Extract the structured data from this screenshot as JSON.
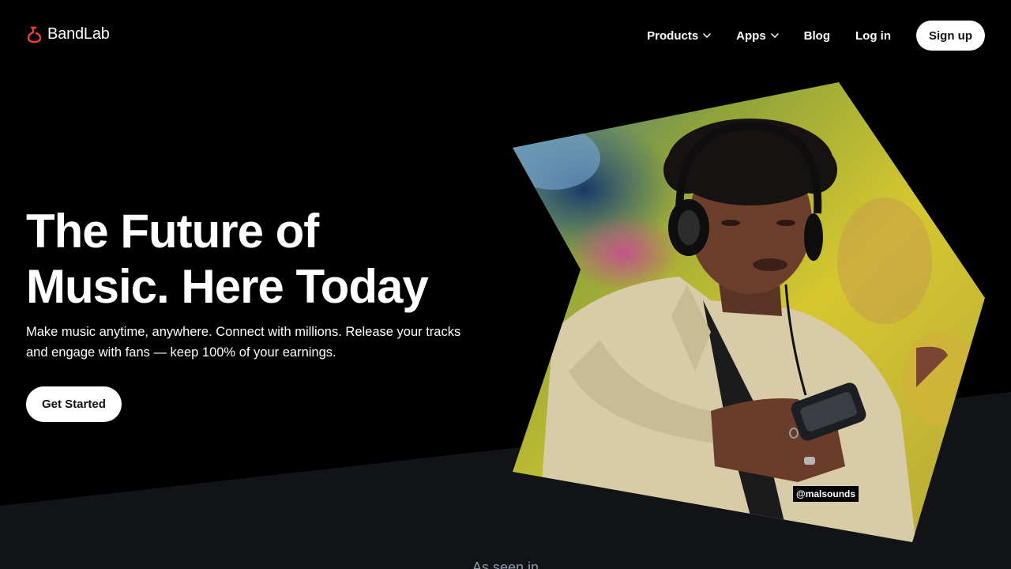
{
  "brand": {
    "name": "BandLab",
    "logo_icon": "bandlab-flask-icon",
    "accent_color": "#f0402f"
  },
  "nav": {
    "items": [
      {
        "label": "Products",
        "has_dropdown": true
      },
      {
        "label": "Apps",
        "has_dropdown": true
      },
      {
        "label": "Blog",
        "has_dropdown": false
      },
      {
        "label": "Log in",
        "has_dropdown": false
      }
    ],
    "signup_label": "Sign up"
  },
  "hero": {
    "title": "The Future of\nMusic. Here Today",
    "subtitle": "Make music anytime, anywhere. Connect with millions. Release your tracks and engage with fans — keep 100% of your earnings.",
    "cta_label": "Get Started",
    "photo_credit": "@malsounds"
  },
  "press": {
    "heading": "As seen in"
  },
  "colors": {
    "background": "#000000",
    "lower_band": "#121316",
    "button_bg": "#ffffff",
    "button_text": "#111111"
  }
}
